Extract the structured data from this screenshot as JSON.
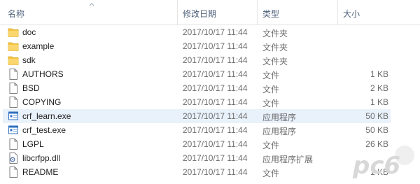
{
  "columns": {
    "name": "名称",
    "date": "修改日期",
    "type": "类型",
    "size": "大小"
  },
  "files": [
    {
      "name": "doc",
      "date": "2017/10/17 11:44",
      "type": "文件夹",
      "size": "",
      "icon": "folder-icon"
    },
    {
      "name": "example",
      "date": "2017/10/17 11:44",
      "type": "文件夹",
      "size": "",
      "icon": "folder-icon"
    },
    {
      "name": "sdk",
      "date": "2017/10/17 11:44",
      "type": "文件夹",
      "size": "",
      "icon": "folder-icon"
    },
    {
      "name": "AUTHORS",
      "date": "2017/10/17 11:44",
      "type": "文件",
      "size": "1 KB",
      "icon": "file-icon"
    },
    {
      "name": "BSD",
      "date": "2017/10/17 11:44",
      "type": "文件",
      "size": "2 KB",
      "icon": "file-icon"
    },
    {
      "name": "COPYING",
      "date": "2017/10/17 11:44",
      "type": "文件",
      "size": "1 KB",
      "icon": "file-icon"
    },
    {
      "name": "crf_learn.exe",
      "date": "2017/10/17 11:44",
      "type": "应用程序",
      "size": "50 KB",
      "icon": "exe-icon",
      "selected": true
    },
    {
      "name": "crf_test.exe",
      "date": "2017/10/17 11:44",
      "type": "应用程序",
      "size": "50 KB",
      "icon": "exe-icon"
    },
    {
      "name": "LGPL",
      "date": "2017/10/17 11:44",
      "type": "文件",
      "size": "26 KB",
      "icon": "file-icon"
    },
    {
      "name": "libcrfpp.dll",
      "date": "2017/10/17 11:44",
      "type": "应用程序扩展",
      "size": "",
      "icon": "dll-icon"
    },
    {
      "name": "README",
      "date": "2017/10/17 11:44",
      "type": "文件",
      "size": "1 KB",
      "icon": "file-icon"
    }
  ],
  "watermark": {
    "text": "pc6"
  },
  "colors": {
    "folder": "#f6c543",
    "selection": "#e9f1fb",
    "header_text": "#4c607a",
    "exe_blue": "#2f6fc1"
  }
}
